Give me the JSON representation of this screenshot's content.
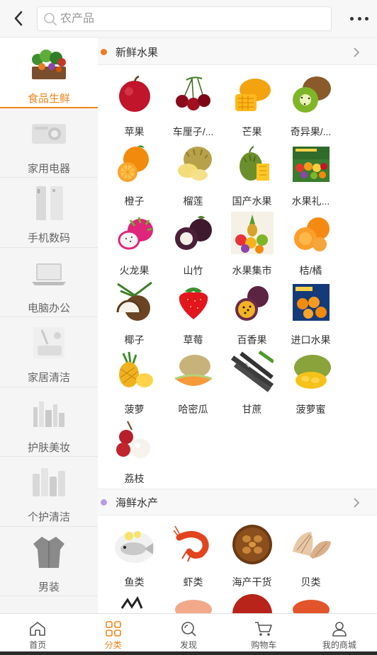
{
  "search": {
    "placeholder": "农产品"
  },
  "icons": {
    "back": "back-arrow-icon",
    "search": "search-icon",
    "more": "more-dots-icon",
    "arrow": "chevron-right-icon"
  },
  "colors": {
    "accent": "#f08519",
    "fruit_dot": "#f07a1e",
    "seafood_dot": "#b89be6"
  },
  "sidebar": {
    "items": [
      {
        "label": "食品生鲜",
        "active": true
      },
      {
        "label": "家用电器"
      },
      {
        "label": "手机数码"
      },
      {
        "label": "电脑办公"
      },
      {
        "label": "家居清洁"
      },
      {
        "label": "护肤美妆"
      },
      {
        "label": "个护清洁"
      },
      {
        "label": "男装"
      }
    ]
  },
  "sections": [
    {
      "title": "新鲜水果",
      "items": [
        {
          "label": "苹果"
        },
        {
          "label": "车厘子/..."
        },
        {
          "label": "芒果"
        },
        {
          "label": "奇异果/..."
        },
        {
          "label": "橙子"
        },
        {
          "label": "榴莲"
        },
        {
          "label": "国产水果"
        },
        {
          "label": "水果礼..."
        },
        {
          "label": "火龙果"
        },
        {
          "label": "山竹"
        },
        {
          "label": "水果集市"
        },
        {
          "label": "桔/橘"
        },
        {
          "label": "椰子"
        },
        {
          "label": "草莓"
        },
        {
          "label": "百香果"
        },
        {
          "label": "进口水果"
        },
        {
          "label": "菠萝"
        },
        {
          "label": "哈密瓜"
        },
        {
          "label": "甘蔗"
        },
        {
          "label": "菠萝蜜"
        },
        {
          "label": "荔枝"
        }
      ]
    },
    {
      "title": "海鲜水产",
      "items": [
        {
          "label": "鱼类"
        },
        {
          "label": "虾类"
        },
        {
          "label": "海产干货"
        },
        {
          "label": "贝类"
        }
      ]
    }
  ],
  "tabbar": {
    "items": [
      {
        "label": "首页"
      },
      {
        "label": "分类",
        "active": true
      },
      {
        "label": "发现"
      },
      {
        "label": "购物车"
      },
      {
        "label": "我的商城"
      }
    ]
  }
}
